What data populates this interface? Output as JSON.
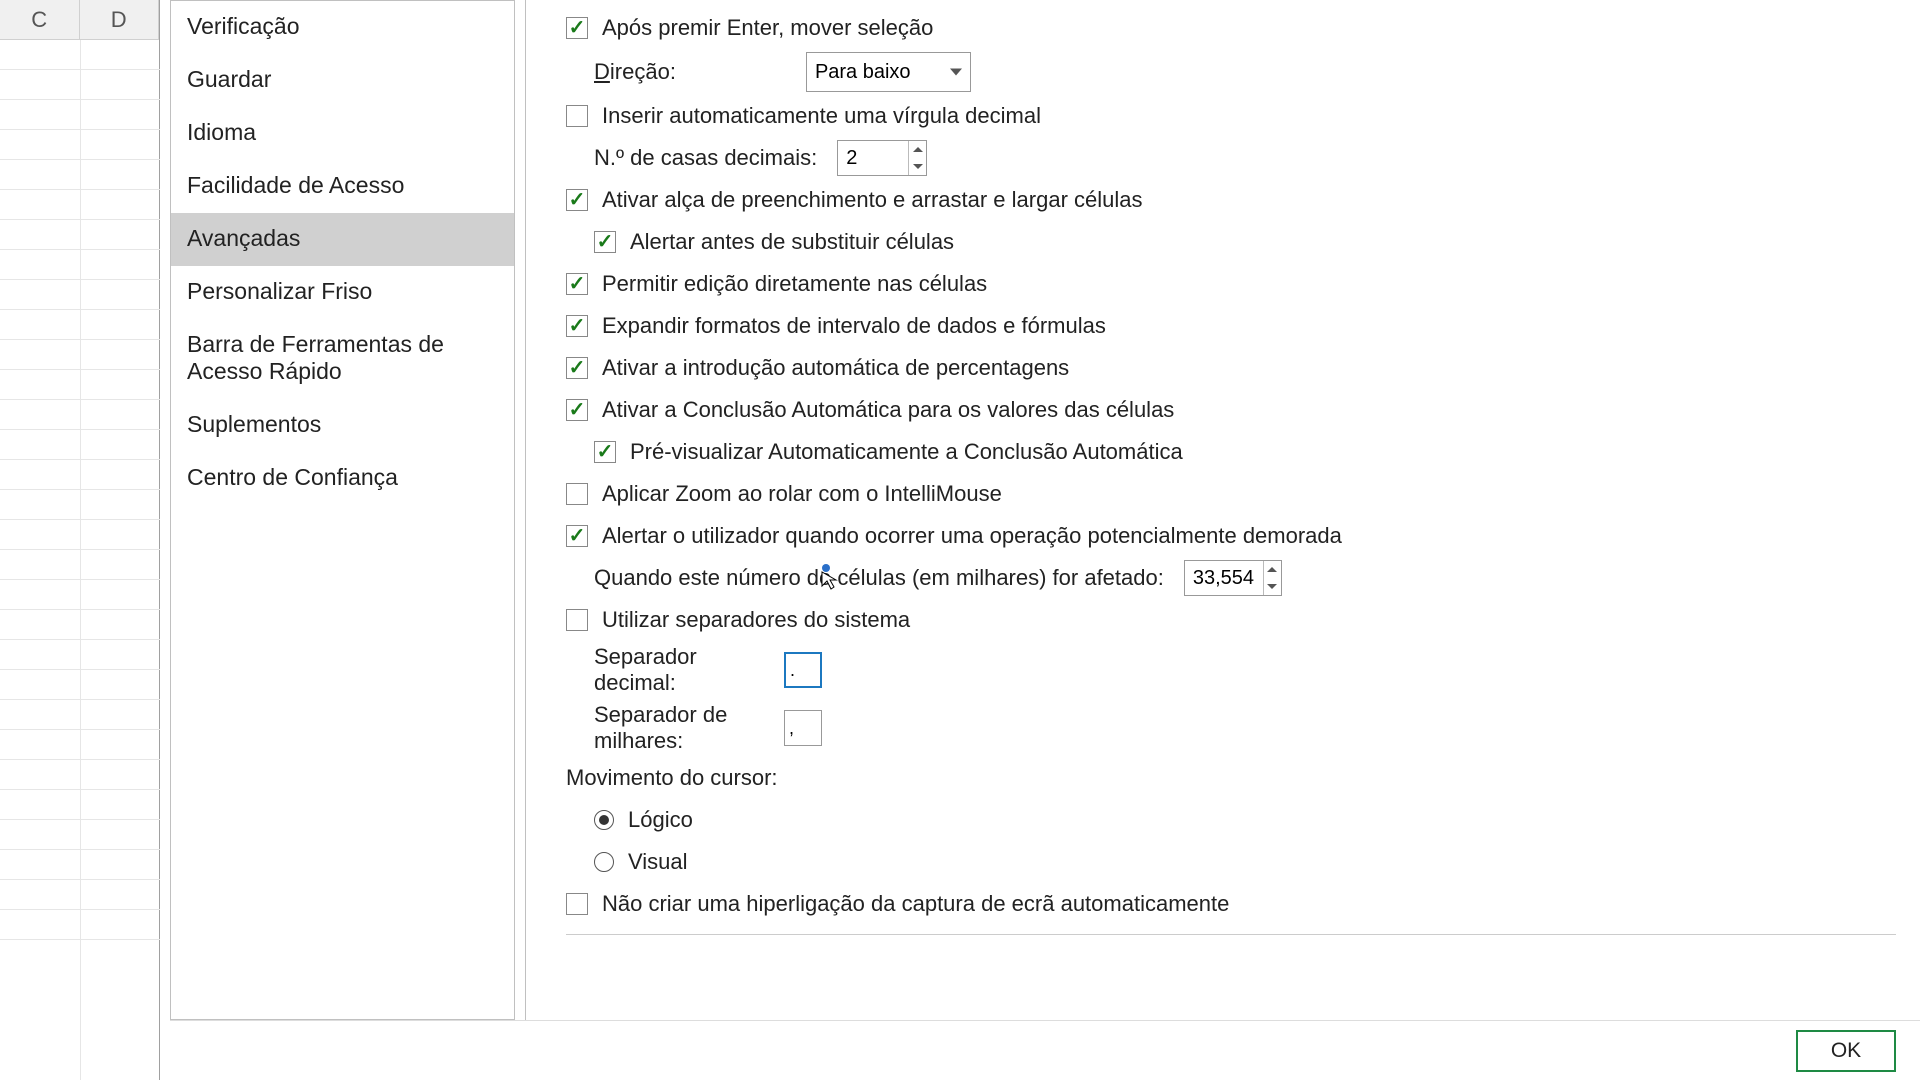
{
  "cols": [
    "C",
    "D"
  ],
  "sidebar": {
    "items": [
      "Verificação",
      "Guardar",
      "Idioma",
      "Facilidade de Acesso",
      "Avançadas",
      "Personalizar Friso",
      "Barra de Ferramentas de Acesso Rápido",
      "Suplementos",
      "Centro de Confiança"
    ],
    "selected_index": 4
  },
  "opts": {
    "after_enter": "Após premir Enter, mover seleção",
    "direction_label": "Direção:",
    "direction_value": "Para baixo",
    "auto_decimal": "Inserir automaticamente uma vírgula decimal",
    "decimal_places_label": "N.º de casas decimais:",
    "decimal_places_value": "2",
    "fill_handle": "Ativar alça de preenchimento e arrastar e largar células",
    "alert_overwrite": "Alertar antes de substituir células",
    "edit_in_cell": "Permitir edição diretamente nas células",
    "extend_formats": "Expandir formatos de intervalo de dados e fórmulas",
    "auto_percent": "Ativar a introdução automática de percentagens",
    "autocomplete": "Ativar a Conclusão Automática para os valores das células",
    "preview_ac": "Pré-visualizar Automaticamente a Conclusão Automática",
    "zoom_intelli": "Aplicar Zoom ao rolar com o IntelliMouse",
    "alert_slow": "Alertar o utilizador quando ocorrer uma operação potencialmente demorada",
    "cells_affected_label": "Quando este número de células (em milhares) for afetado:",
    "cells_affected_value": "33,554",
    "system_sep": "Utilizar separadores do sistema",
    "decimal_sep_label": "Separador decimal:",
    "decimal_sep_value": ".",
    "thousand_sep_label": "Separador de milhares:",
    "thousand_sep_value": ",",
    "cursor_move": "Movimento do cursor:",
    "logical": "Lógico",
    "visual": "Visual",
    "no_hyperlink": "Não criar uma hiperligação da captura de ecrã automaticamente"
  },
  "buttons": {
    "ok": "OK"
  }
}
